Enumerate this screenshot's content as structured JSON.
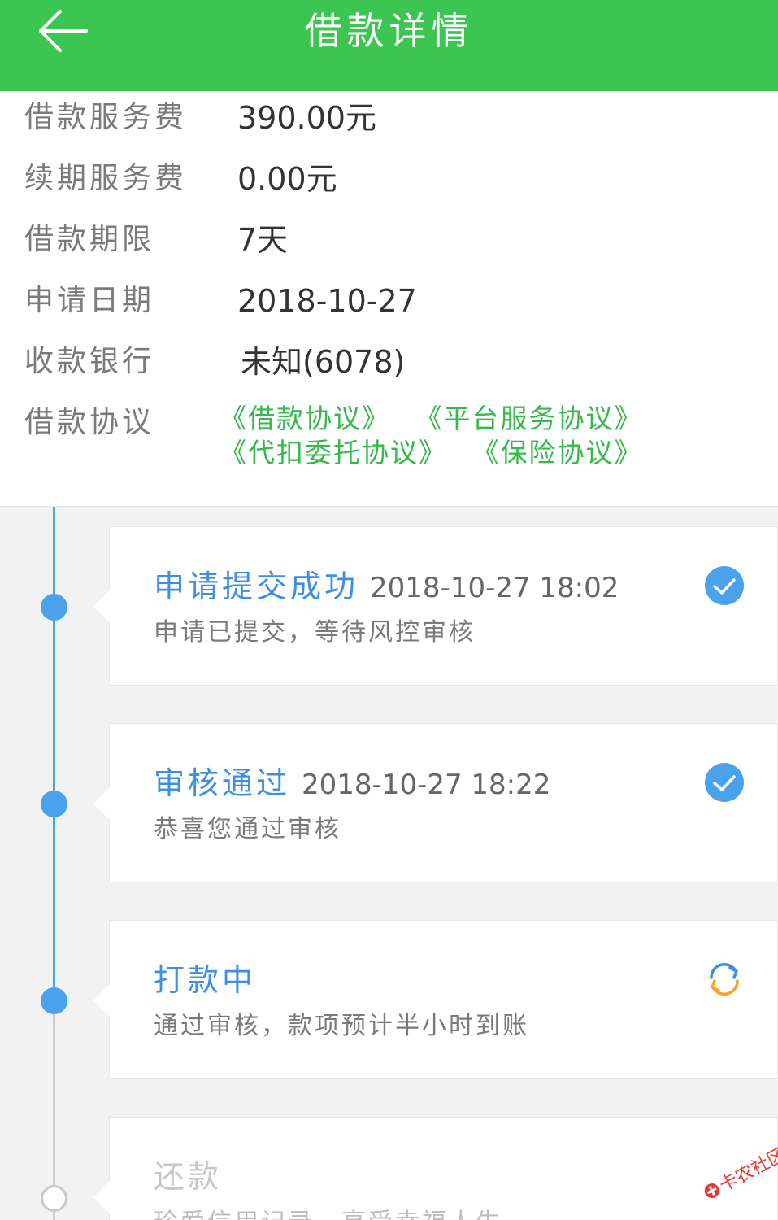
{
  "header": {
    "title": "借款详情",
    "back_icon": "back-arrow-icon",
    "bg_color": "#3cc551"
  },
  "info": {
    "rows": [
      {
        "label": "借款服务费",
        "value": "390.00元"
      },
      {
        "label": "续期服务费",
        "value": "0.00元"
      },
      {
        "label": "借款期限",
        "value": "7天"
      },
      {
        "label": "申请日期",
        "value": "2018-10-27"
      },
      {
        "label": "收款银行",
        "value": "未知(6078)"
      }
    ],
    "agreements": {
      "label": "借款协议",
      "links": [
        "《借款协议》",
        "《平台服务协议》",
        "《代扣委托协议》",
        "《保险协议》"
      ],
      "link_color": "#35b94a"
    }
  },
  "timeline": {
    "steps": [
      {
        "title": "申请提交成功",
        "time": "2018-10-27 18:02",
        "desc": "申请已提交，等待风控审核",
        "status_icon": "check-circle-icon"
      },
      {
        "title": "审核通过",
        "time": "2018-10-27 18:22",
        "desc": "恭喜您通过审核",
        "status_icon": "check-circle-icon"
      },
      {
        "title": "打款中",
        "time": "",
        "desc": "通过审核，款项预计半小时到账",
        "status_icon": "refresh-icon"
      },
      {
        "title": "还款",
        "time": "",
        "desc": "珍爱信用记录，享受幸福人生",
        "status_icon": ""
      }
    ],
    "active_color": "#4aa2ec",
    "pending_color": "#f5a623"
  },
  "watermark": {
    "text": "卡农社区",
    "icon": "kanong-logo-icon"
  }
}
